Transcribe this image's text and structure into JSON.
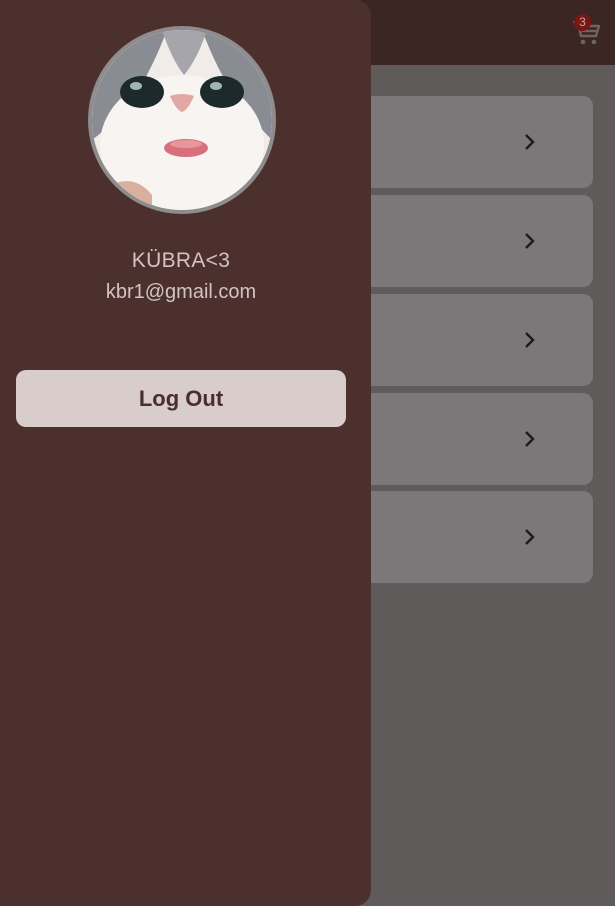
{
  "app_bar": {
    "cart_icon": "cart-icon",
    "cart_badge_count": "3"
  },
  "list": {
    "items": [
      {
        "chevron_icon": "chevron-right-icon"
      },
      {
        "chevron_icon": "chevron-right-icon"
      },
      {
        "chevron_icon": "chevron-right-icon"
      },
      {
        "chevron_icon": "chevron-right-icon"
      },
      {
        "chevron_icon": "chevron-right-icon"
      }
    ]
  },
  "drawer": {
    "avatar_image": "cat-avatar",
    "user_name": "KÜBRA<3",
    "user_email": "kbr1@gmail.com",
    "logout_label": "Log Out"
  },
  "colors": {
    "drawer_background": "#4c302e",
    "app_bar": "#3c2624",
    "scrim_background": "#5f5b5a",
    "card": "#7a7878",
    "button_background": "#d8cdcb",
    "badge": "#7a1613"
  }
}
